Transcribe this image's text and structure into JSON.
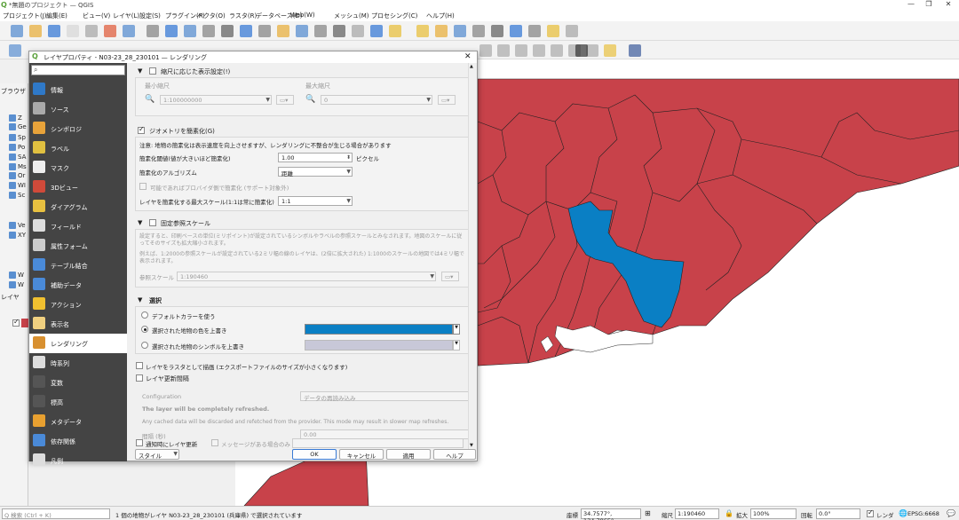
{
  "app": {
    "window_title": "*無題のプロジェクト — QGIS",
    "menu": [
      "プロジェクト(J)",
      "編集(E)",
      "ビュー(V)",
      "レイヤ(L)",
      "設定(S)",
      "プラグイン(P)",
      "ベクタ(O)",
      "ラスタ(R)",
      "データベース(D)",
      "Web(W)",
      "メッシュ(M)",
      "プロセシング(C)",
      "ヘルプ(H)"
    ]
  },
  "left_panel": {
    "browser_label": "ブラウザ",
    "layers_label": "レイヤ",
    "tree_items": [
      "Z",
      "Ge",
      "Sp",
      "Po",
      "SA",
      "Ms",
      "Or",
      "WI",
      "Sc",
      "Ve",
      "XY",
      "W",
      "W"
    ]
  },
  "dialog": {
    "title": "レイヤプロパティ - N03-23_28_230101 — レンダリング",
    "close_icon": "close-icon",
    "search_placeholder": "",
    "sidebar": [
      {
        "label": "情報",
        "icon": "info-icon",
        "color": "#2f79c8"
      },
      {
        "label": "ソース",
        "icon": "source-icon",
        "color": "#aaaaaa"
      },
      {
        "label": "シンボロジ",
        "icon": "symbology-icon",
        "color": "#e8a33a"
      },
      {
        "label": "ラベル",
        "icon": "labels-icon",
        "color": "#e0c040"
      },
      {
        "label": "マスク",
        "icon": "mask-icon",
        "color": "#eeeeee"
      },
      {
        "label": "3Dビュー",
        "icon": "cube-icon",
        "color": "#d04a3a"
      },
      {
        "label": "ダイアグラム",
        "icon": "diagram-icon",
        "color": "#e8c040"
      },
      {
        "label": "フィールド",
        "icon": "fields-icon",
        "color": "#dddddd"
      },
      {
        "label": "属性フォーム",
        "icon": "form-icon",
        "color": "#cccccc"
      },
      {
        "label": "テーブル結合",
        "icon": "join-icon",
        "color": "#4a8ad8"
      },
      {
        "label": "補助データ",
        "icon": "auxiliary-icon",
        "color": "#4a8ad8"
      },
      {
        "label": "アクション",
        "icon": "action-icon",
        "color": "#f0c030"
      },
      {
        "label": "表示名",
        "icon": "display-icon",
        "color": "#f0d080"
      },
      {
        "label": "レンダリング",
        "icon": "brush-icon",
        "color": "#d89030"
      },
      {
        "label": "時系列",
        "icon": "clock-icon",
        "color": "#dddddd"
      },
      {
        "label": "変数",
        "icon": "variable-icon",
        "color": "#555555"
      },
      {
        "label": "標高",
        "icon": "elevation-icon",
        "color": "#555555"
      },
      {
        "label": "メタデータ",
        "icon": "metadata-icon",
        "color": "#e8a030"
      },
      {
        "label": "依存関係",
        "icon": "dependency-icon",
        "color": "#4a8ad8"
      },
      {
        "label": "凡例",
        "icon": "legend-icon",
        "color": "#dddddd"
      }
    ],
    "active_index": 13,
    "scale_visibility": {
      "header": "縮尺に応じた表示設定(!)",
      "min_label": "最小縮尺",
      "max_label": "最大縮尺",
      "min_value": "1:100000000",
      "max_value": "0"
    },
    "simplify": {
      "header": "ジオメトリを簡素化(G)",
      "note": "注意: 地物の簡素化は表示速度を向上させますが、レンダリングに不整合が生じる場合があります",
      "threshold_label": "簡素化閾値(値が大きいほど簡素化)",
      "threshold_value": "1.00",
      "threshold_unit": "ピクセル",
      "algorithm_label": "簡素化のアルゴリズム",
      "algorithm_value": "距離",
      "provider_label": "可能であればプロバイダ側で簡素化 (サポート対象外)",
      "max_scale_label": "レイヤを簡素化する最大スケール(1:1は常に簡素化)",
      "max_scale_value": "1:1"
    },
    "ref_scale": {
      "header": "固定参照スケール",
      "desc1": "設定すると、印刷ベースの単位(ミリポイント)が設定されているシンボルやラベルの参照スケールとみなされます。地図のスケールに従ってそのサイズも拡大縮小されます。",
      "desc2": "例えば、1:2000の参照スケールが設定されている2ミリ幅の線のレイヤは、(2倍に拡大された) 1:1000のスケールの地図では4ミリ幅で表示されます。",
      "label": "参照スケール",
      "value": "1:190460"
    },
    "selection": {
      "header": "選択",
      "opt1": "デフォルトカラーを使う",
      "opt2": "選択された地物の色を上書き",
      "opt3": "選択された地物のシンボルを上書き",
      "color": "#0a7fc4",
      "symbol_color": "#c8c8d8"
    },
    "raster_render_label": "レイヤをラスタとして描画 (エクスポートファイルのサイズが小さくなります)",
    "refresh": {
      "header": "レイヤ更新間隔",
      "config_label": "Configuration",
      "config_value": "データの再読み込み",
      "bold_note": "The layer will be completely refreshed.",
      "note": "Any cached data will be discarded and refetched from the provider. This mode may result in slower map refreshes.",
      "interval_label": "間隔 (秒)",
      "interval_value": "0.00"
    },
    "bottom": {
      "auto_refresh_label": "通知時にレイヤ更新",
      "message_label": "メッセージがある場合のみ",
      "style_label": "スタイル",
      "ok": "OK",
      "cancel": "キャンセル",
      "apply": "適用",
      "help": "ヘルプ"
    }
  },
  "map": {
    "fill_color": "#c8424a",
    "selected_color": "#0a7fc4"
  },
  "statusbar": {
    "search_placeholder": "Q 検索 (Ctrl + K)",
    "message": "1 個の地物がレイヤ N03-23_28_230101 (兵庫県) で選択されています",
    "coord_label": "座標",
    "coord_value": "34.7577°, 134.7865°",
    "scale_label": "縮尺",
    "scale_value": "1:190460",
    "magnifier_label": "拡大",
    "magnifier_value": "100%",
    "rotation_label": "回転",
    "rotation_value": "0.0°",
    "render_label": "レンダ",
    "crs": "EPSG:6668"
  }
}
